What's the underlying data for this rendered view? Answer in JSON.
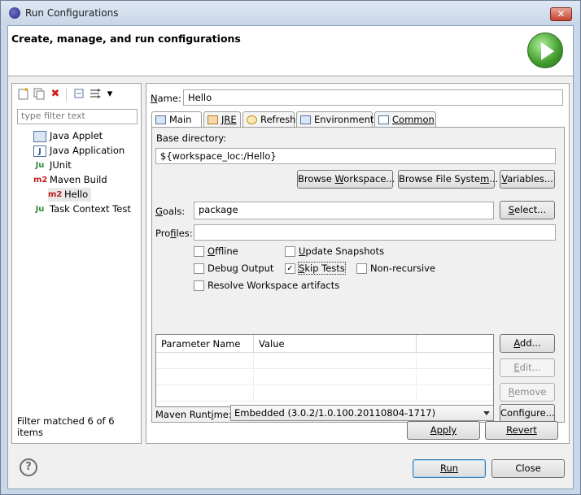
{
  "window": {
    "title": "Run Configurations",
    "close_glyph": "✕"
  },
  "header": {
    "title": "Create, manage, and run configurations"
  },
  "toolbar": {
    "icons": [
      "new-config-icon",
      "duplicate-icon",
      "delete-icon",
      "collapse-all-icon",
      "filter-icon",
      "menu-dropdown-icon"
    ],
    "delete_glyph": "✖",
    "dropdown_glyph": "▾"
  },
  "filter": {
    "placeholder": "type filter text"
  },
  "tree": {
    "items": [
      {
        "label": "Java Applet",
        "icon": "java-applet-icon"
      },
      {
        "label": "Java Application",
        "icon": "java-application-icon",
        "glyph": "J"
      },
      {
        "label": "JUnit",
        "icon": "junit-icon",
        "glyph": "Ju"
      },
      {
        "label": "Maven Build",
        "icon": "maven-icon",
        "glyph": "m2"
      },
      {
        "label": "Hello",
        "icon": "maven-icon",
        "glyph": "m2",
        "selected": true
      },
      {
        "label": "Task Context Test",
        "icon": "junit-icon",
        "glyph": "Ju"
      }
    ],
    "status": "Filter matched 6 of 6 items"
  },
  "form": {
    "name_label_u": "N",
    "name_label_rest": "ame:",
    "name_value": "Hello",
    "tabs": [
      {
        "label": "Main",
        "icon": "main-tab-icon",
        "active": true
      },
      {
        "label": "JRE",
        "icon": "jre-icon"
      },
      {
        "label": "Refresh",
        "icon": "refresh-icon"
      },
      {
        "label": "Environment",
        "icon": "environment-icon"
      },
      {
        "label": "Common",
        "icon": "common-icon"
      }
    ],
    "base_directory_label": "Base directory:",
    "base_directory_value": "${workspace_loc:/Hello}",
    "browse_workspace": {
      "a": "Browse ",
      "u": "W",
      "b": "orkspace..."
    },
    "browse_filesystem": {
      "a": "Browse File Syste",
      "u": "m",
      "b": "..."
    },
    "variables": {
      "a": "",
      "u": "V",
      "b": "ariables..."
    },
    "goals_label": {
      "u": "G",
      "b": "oals:"
    },
    "goals_value": "package",
    "select_button": {
      "u": "S",
      "b": "elect..."
    },
    "profiles_label": {
      "a": "Pro",
      "u": "f",
      "b": "iles:"
    },
    "profiles_value": "",
    "checkboxes": {
      "offline": {
        "u": "O",
        "b": "ffline",
        "checked": false
      },
      "update_snapshots": {
        "u": "U",
        "b": "pdate Snapshots",
        "checked": false
      },
      "debug_output": {
        "a": "Debu",
        "u": "g",
        "b": " Output",
        "checked": false
      },
      "skip_tests": {
        "u": "S",
        "b": "kip Tests",
        "checked": true
      },
      "non_recursive": {
        "label": "Non-recursive",
        "checked": false
      },
      "resolve_workspace": {
        "label": "Resolve Workspace artifacts",
        "checked": false
      }
    },
    "check_glyph": "✓",
    "params_table": {
      "columns": [
        "Parameter Name",
        "Value",
        ""
      ],
      "rows": []
    },
    "add_button": {
      "u": "A",
      "b": "dd..."
    },
    "edit_button": {
      "u": "E",
      "b": "dit..."
    },
    "remove_button": {
      "u": "R",
      "b": "emove"
    },
    "maven_runtime_label": {
      "a": "Maven Runt",
      "u": "i",
      "b": "me:"
    },
    "maven_runtime_value": "Embedded (3.0.2/1.0.100.20110804-1717)",
    "configure_button": "Configure...",
    "apply_button": "Apply",
    "revert_button": "Revert"
  },
  "footer": {
    "help_glyph": "?",
    "run_button": "Run",
    "close_button": "Close"
  }
}
